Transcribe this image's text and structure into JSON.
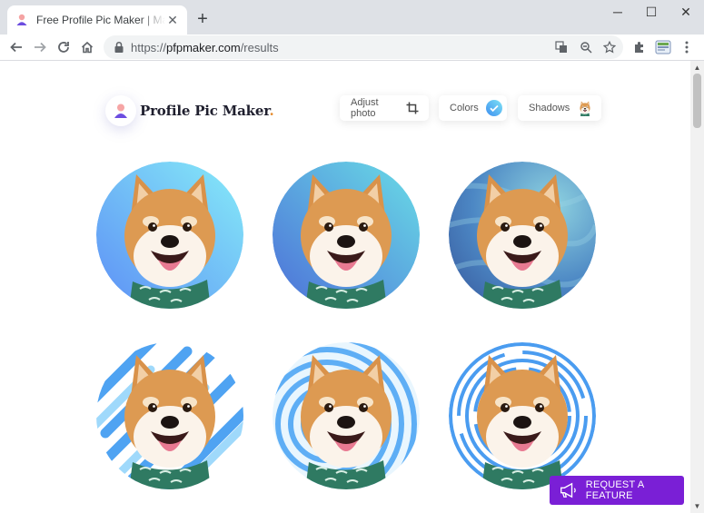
{
  "browser": {
    "tab_title": "Free Profile Pic Maker | Make a Profile Picture",
    "tab_close": "✕",
    "new_tab": "+",
    "url_scheme": "https://",
    "url_host": "pfpmaker.com",
    "url_path": "/results",
    "window_minimize": "─",
    "window_maximize": "☐",
    "window_close": "✕"
  },
  "header": {
    "brand_name": "Profile Pic Maker",
    "brand_dot": ".",
    "buttons": [
      {
        "label": "Adjust photo",
        "icon": "crop-icon"
      },
      {
        "label": "Colors",
        "icon": "check-circle-icon"
      },
      {
        "label": "Shadows",
        "icon": "dog-thumbnail-icon"
      }
    ]
  },
  "results": [
    {
      "style": "gradient-blue"
    },
    {
      "style": "gradient-teal"
    },
    {
      "style": "textured-blue"
    },
    {
      "style": "diagonal-stripes"
    },
    {
      "style": "fingerprint-swirl"
    },
    {
      "style": "concentric-rings"
    }
  ],
  "request_feature": {
    "label": "REQUEST A FEATURE",
    "icon": "megaphone-icon"
  },
  "colors": {
    "accent_purple": "#7a1fd6",
    "brand_dot": "#e58b2c",
    "check_blue": "#4fa6f5"
  }
}
